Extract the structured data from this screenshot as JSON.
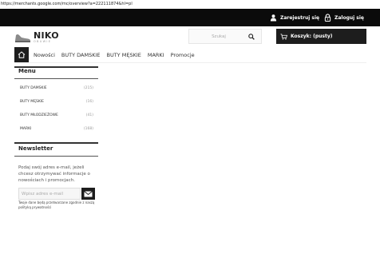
{
  "browser": {
    "url": "https://merchants.google.com/mc/overview?a=222111874&hl=pl"
  },
  "topbar": {
    "register_label": "Zarejestruj się",
    "login_label": "Zaloguj się"
  },
  "logo": {
    "name": "NIKO",
    "sub": "OBUWIE"
  },
  "search": {
    "placeholder": "Szukaj"
  },
  "cart": {
    "label": "Koszyk: (pusty)"
  },
  "nav": {
    "items": [
      "Nowości",
      "BUTY DAMSKIE",
      "BUTY MĘSKIE",
      "MARKI",
      "Promocje"
    ]
  },
  "menu": {
    "title": "Menu",
    "items": [
      {
        "label": "BUTY DAMSKIE",
        "count": "(215)"
      },
      {
        "label": "BUTY MĘSKIE",
        "count": "(16)"
      },
      {
        "label": "BUTY MŁODZIEŻOWE",
        "count": "(41)"
      },
      {
        "label": "MARKI",
        "count": "(168)"
      }
    ]
  },
  "newsletter": {
    "title": "Newsletter",
    "text": "Podaj swój adres e-mail, jeżeli chcesz otrzymywać informacje o nowościach i promocjach.",
    "placeholder": "Wpisz adres e-mail",
    "note": "Twoje dane będą przetwarzane zgodnie z naszą polityką prywatności"
  },
  "colors": {
    "topbar": "#0b0b0b",
    "dark": "#1d1d1d",
    "accent_text": "#333333"
  }
}
